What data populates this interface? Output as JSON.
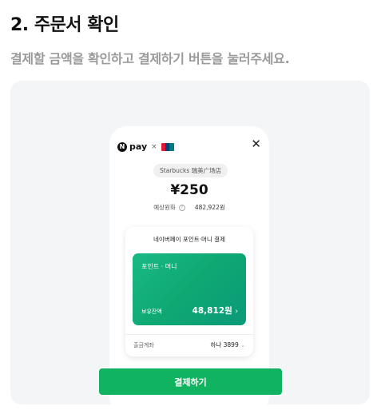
{
  "heading": {
    "title": "2. 주문서 확인",
    "subtitle": "결제할 금액을 확인하고 결제하기 버튼을 눌러주세요."
  },
  "phone": {
    "brand_letter": "N",
    "brand_pay": "pay",
    "brand_times": "×",
    "close_symbol": "✕",
    "store_name": "Starbucks 瑞美广场店",
    "amount": "¥250",
    "estimate_label": "예상원화",
    "estimate_info": "?",
    "estimate_value": "482,922원",
    "card_section": {
      "header": "네이버페이 포인트·머니 결제",
      "card_title": "포인트 · 머니",
      "balance_label": "보유잔액",
      "balance_value": "48,812원",
      "balance_chevron": "›",
      "withdraw_label": "출금계좌",
      "withdraw_value": "하나 3899",
      "withdraw_dropdown": "⌄"
    },
    "pay_button": "결제하기"
  },
  "colors": {
    "pay_green": "#10b35f",
    "card_green": "#0fa873",
    "panel_bg": "#f4f5f7",
    "subtitle_gray": "#9a9a9a"
  },
  "icons": [
    "naver-n-icon",
    "unionpay-logo",
    "close-icon",
    "info-icon",
    "chevron-right-icon",
    "chevron-down-icon"
  ]
}
